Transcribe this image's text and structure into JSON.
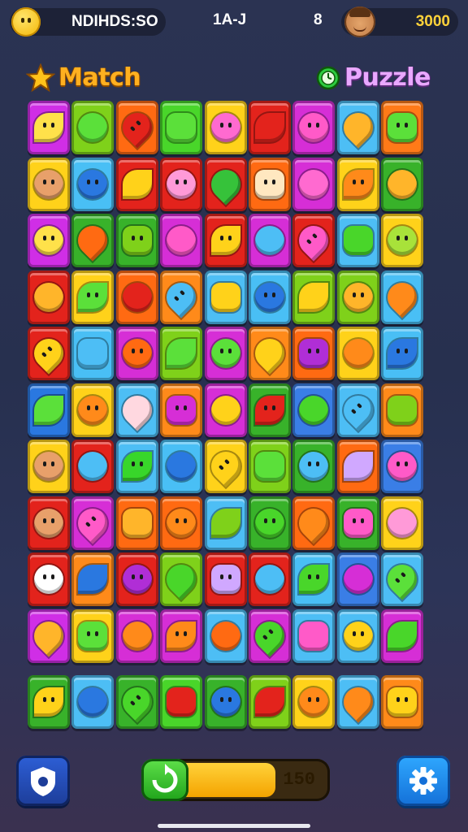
{
  "header": {
    "left_label": "NDIHDS:SO",
    "level_label": "1A-J",
    "hash_label": "8",
    "score": "3000"
  },
  "titles": {
    "left": "Match",
    "right": "Puzzle"
  },
  "board": {
    "rows": [
      [
        "#d02ee6",
        "#7fd11a",
        "#ff6a12",
        "#49d62a",
        "#ffd21a",
        "#e3231c",
        "#d62ed6",
        "#4dbef5",
        "#ff7a18"
      ],
      [
        "#ffd21a",
        "#49bff5",
        "#e3231c",
        "#e3231c",
        "#e3231c",
        "#ff6a12",
        "#d62ed6",
        "#ffd21a",
        "#38b22a"
      ],
      [
        "#d02ee6",
        "#38b22a",
        "#38b22a",
        "#d62ed6",
        "#e3231c",
        "#d62ed6",
        "#e3231c",
        "#4dbef5",
        "#ffd21a"
      ],
      [
        "#e3231c",
        "#ffd21a",
        "#ff6a12",
        "#ff8a1a",
        "#4dbef5",
        "#49bff5",
        "#7fd11a",
        "#7fd11a",
        "#49bff5"
      ],
      [
        "#e3231c",
        "#49bff5",
        "#d62ed6",
        "#7fd11a",
        "#d62ed6",
        "#ff8a1a",
        "#ff6a12",
        "#ffd21a",
        "#49bff5"
      ],
      [
        "#2a78e0",
        "#ffd21a",
        "#4dbef5",
        "#ff8a1a",
        "#d62ed6",
        "#38b22a",
        "#3a7ee6",
        "#4dbef5",
        "#ff8a1a"
      ],
      [
        "#ffd21a",
        "#e3231c",
        "#4dbef5",
        "#49bff5",
        "#ffd21a",
        "#7fd11a",
        "#38b22a",
        "#ff6a12",
        "#3a7ee6"
      ],
      [
        "#e3231c",
        "#d62ed6",
        "#ff6a12",
        "#ff6a12",
        "#4dbef5",
        "#38b22a",
        "#ff6a12",
        "#38b22a",
        "#ffd21a"
      ],
      [
        "#e3231c",
        "#ff8a1a",
        "#e3231c",
        "#7fd11a",
        "#e3231c",
        "#e3231c",
        "#49bff5",
        "#3a7ee6",
        "#4dbef5"
      ],
      [
        "#d02ee6",
        "#ffd21a",
        "#d62ed6",
        "#d62ed6",
        "#4dbef5",
        "#d62ed6",
        "#4dbef5",
        "#4dbef5",
        "#d62ed6"
      ],
      [
        "#38b22a",
        "#4dbef5",
        "#38b22a",
        "#49d62a",
        "#38b22a",
        "#7fd11a",
        "#ffd21a",
        "#4dbef5",
        "#ff8a1a"
      ]
    ],
    "symbols": [
      [
        "#ffe14a",
        "#5be03a",
        "#e3231c",
        "#5be03a",
        "#ff6ad0",
        "#e3231c",
        "#ff5ac8",
        "#ffb52a",
        "#5be03a"
      ],
      [
        "face",
        "#2a78e0",
        "#ffd21a",
        "#ff9ad8",
        "#36c23a",
        "#ffe8c0",
        "#ff6ad0",
        "#ff8a1a",
        "#ffb52a"
      ],
      [
        "#ffe14a",
        "#ff6a12",
        "#7fd11a",
        "#ff5ac8",
        "#ffd21a",
        "#4dbef5",
        "#ff5ac8",
        "#49d62a",
        "#a8e23a"
      ],
      [
        "#ffb52a",
        "#5be03a",
        "#e3231c",
        "#4dbef5",
        "#ffd21a",
        "#2a78e0",
        "#ffd21a",
        "#ffb52a",
        "#ff8a1a"
      ],
      [
        "#ffd21a",
        "#4dbef5",
        "#ff6a12",
        "#5be03a",
        "#5be03a",
        "#ffd21a",
        "#b02ed6",
        "#ff8a1a",
        "#2a78e0"
      ],
      [
        "#5be03a",
        "#ff8a1a",
        "#ffd8e0",
        "#d62ed6",
        "#ffd21a",
        "#e3231c",
        "#49d62a",
        "#4dbef5",
        "#7fd11a"
      ],
      [
        "face",
        "#4dbef5",
        "#38d62a",
        "#2a78e0",
        "#ffd21a",
        "#5be03a",
        "#4dbef5",
        "#d0a8ff",
        "#ff5ac8"
      ],
      [
        "face",
        "#ff5ac8",
        "#ffb52a",
        "#ff8a1a",
        "#7fd11a",
        "#49d62a",
        "#ff8a1a",
        "#ff5ac8",
        "#ff9ad8"
      ],
      [
        "#ffffff",
        "#2a78e0",
        "#b02ed6",
        "#49d62a",
        "#d0a8ff",
        "#4dbef5",
        "#49d62a",
        "#d62ed6",
        "#5be03a"
      ],
      [
        "#ffb52a",
        "#5be03a",
        "#ff8a1a",
        "#ff8a1a",
        "#ff6a12",
        "#49d62a",
        "#ff5ac8",
        "#ffd21a",
        "#49d62a"
      ],
      [
        "#ffd21a",
        "#2a78e0",
        "#49d62a",
        "#e3231c",
        "#2a78e0",
        "#e3231c",
        "#ff8a1a",
        "#ff8a1a",
        "#ffd21a"
      ]
    ]
  },
  "footer": {
    "progress_value": "150",
    "progress_fraction": 0.72
  },
  "colors": {
    "title_match": "#ffb020",
    "title_puzzle": "#e9a8ff",
    "score": "#ffd23a"
  },
  "icons": {
    "top_left": "smiley-icon",
    "top_right": "player-avatar-icon",
    "match": "star-icon",
    "puzzle": "clock-icon",
    "bottom_left": "shield-icon",
    "bottom_right": "gear-icon",
    "progress": "refresh-icon"
  }
}
